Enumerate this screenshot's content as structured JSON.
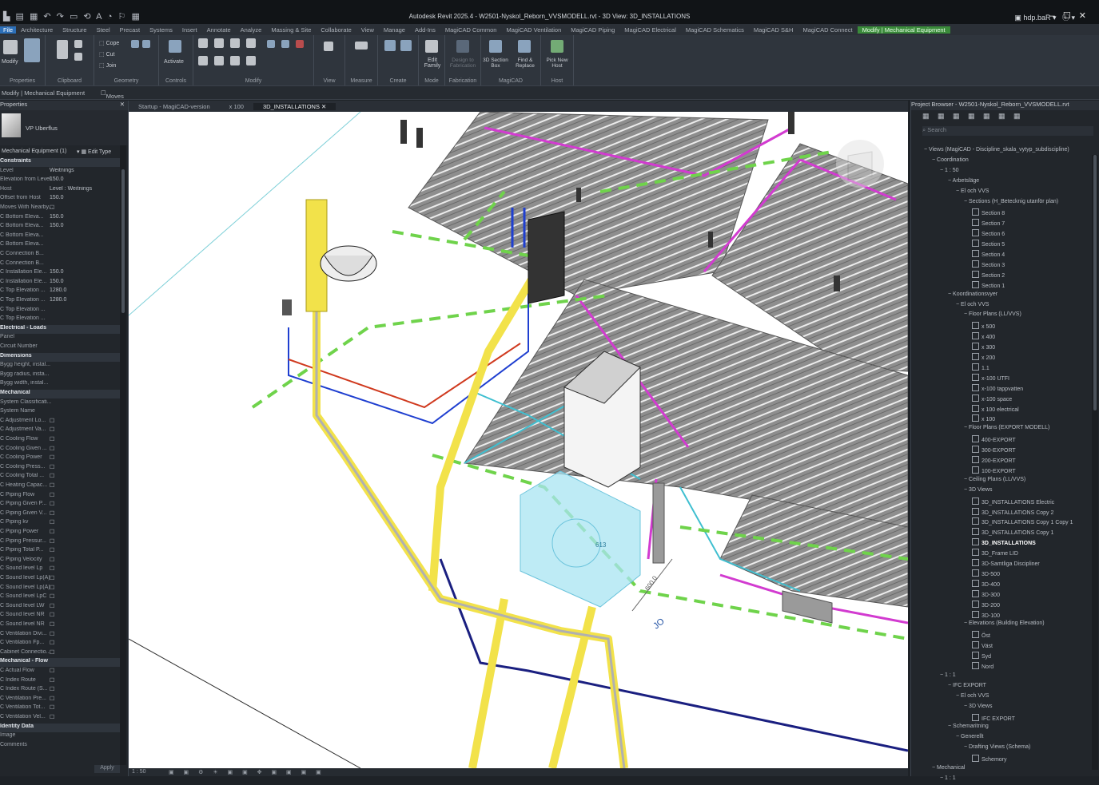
{
  "window": {
    "title": "Autodesk Revit 2025.4 - W2501-Nyskol_Reborn_VVSMODELL.rvt - 3D View: 3D_INSTALLATIONS",
    "user": "hdp.baR",
    "qat": "▙ ▤ ▦ ↶ ↷ ▭ ⟲ A ◔ ⚐ ▦"
  },
  "ribbon": {
    "tabs": [
      "File",
      "Architecture",
      "Structure",
      "Steel",
      "Precast",
      "Systems",
      "Insert",
      "Annotate",
      "Analyze",
      "Massing & Site",
      "Collaborate",
      "View",
      "Manage",
      "Add-Ins",
      "MagiCAD Common",
      "MagiCAD Ventilation",
      "MagiCAD Piping",
      "MagiCAD Electrical",
      "MagiCAD Schematics",
      "MagiCAD S&H",
      "MagiCAD Connect",
      "Modify | Mechanical Equipment"
    ],
    "groups": [
      "Properties",
      "Clipboard",
      "Geometry",
      "Controls",
      "Modify",
      "View",
      "Measure",
      "Create",
      "Mode",
      "Fabrication",
      "MagiCAD",
      "Host"
    ],
    "buttons": {
      "modify": "Modify",
      "cope": "Cope",
      "cut": "Cut",
      "join": "Join",
      "activate": "Activate",
      "edit_family": "Edit Family",
      "design_to_fabrication": "Design to Fabrication",
      "section_box": "3D Section Box",
      "find_replace": "Find & Replace",
      "pick_new_host": "Pick New Host"
    }
  },
  "options_bar": {
    "context": "Modify | Mechanical Equipment",
    "moves_with": "Moves With Nearby Elements"
  },
  "properties": {
    "title": "Properties",
    "type_name": "VP Uberflus",
    "selector": "Mechanical Equipment (1)",
    "edit_type": "Edit Type",
    "apply": "Apply",
    "rows": [
      {
        "cat": true,
        "label": "Constraints"
      },
      {
        "label": "Level",
        "value": "Weitnings"
      },
      {
        "label": "Elevation from Level",
        "value": "150.0"
      },
      {
        "label": "Host",
        "value": "Level : Weitnings"
      },
      {
        "label": "Offset from Host",
        "value": "150.0"
      },
      {
        "label": "Moves With Nearby...",
        "value": "☐"
      },
      {
        "label": "C Bottom Eleva...",
        "value": "150.0"
      },
      {
        "label": "C Bottom Eleva...",
        "value": "150.0"
      },
      {
        "label": "C Bottom Eleva...",
        "value": ""
      },
      {
        "label": "C Bottom Eleva...",
        "value": ""
      },
      {
        "label": "C Connection B...",
        "value": ""
      },
      {
        "label": "C Connection B...",
        "value": ""
      },
      {
        "label": "C Installation Ele...",
        "value": "150.0"
      },
      {
        "label": "C Installation Ele...",
        "value": "150.0"
      },
      {
        "label": "C Top Elevation ...",
        "value": "1280.0"
      },
      {
        "label": "C Top Elevation ...",
        "value": "1280.0"
      },
      {
        "label": "C Top Elevation ...",
        "value": ""
      },
      {
        "label": "C Top Elevation ...",
        "value": ""
      },
      {
        "cat": true,
        "label": "Electrical - Loads"
      },
      {
        "label": "Panel",
        "value": ""
      },
      {
        "label": "Circuit Number",
        "value": ""
      },
      {
        "cat": true,
        "label": "Dimensions"
      },
      {
        "label": "Bygg height, instal...",
        "value": ""
      },
      {
        "label": "Bygg radius, insta...",
        "value": ""
      },
      {
        "label": "Bygg width, instal...",
        "value": ""
      },
      {
        "cat": true,
        "label": "Mechanical"
      },
      {
        "label": "System Classificati...",
        "value": ""
      },
      {
        "label": "System Name",
        "value": ""
      },
      {
        "label": "C Adjustment Lo...",
        "value": "☐"
      },
      {
        "label": "C Adjustment Va...",
        "value": "☐"
      },
      {
        "label": "C Cooling Flow",
        "value": "☐"
      },
      {
        "label": "C Cooling Given ...",
        "value": "☐"
      },
      {
        "label": "C Cooling Power",
        "value": "☐"
      },
      {
        "label": "C Cooling Press...",
        "value": "☐"
      },
      {
        "label": "C Cooling Total ...",
        "value": "☐"
      },
      {
        "label": "C Heating Capac...",
        "value": "☐"
      },
      {
        "label": "C Piping Flow",
        "value": "☐"
      },
      {
        "label": "C Piping Given P...",
        "value": "☐"
      },
      {
        "label": "C Piping Given V...",
        "value": "☐"
      },
      {
        "label": "C Piping kv",
        "value": "☐"
      },
      {
        "label": "C Piping Power",
        "value": "☐"
      },
      {
        "label": "C Piping Pressur...",
        "value": "☐"
      },
      {
        "label": "C Piping Total P...",
        "value": "☐"
      },
      {
        "label": "C Piping Velocity",
        "value": "☐"
      },
      {
        "label": "C Sound level Lp",
        "value": "☐"
      },
      {
        "label": "C Sound level Lp(A)",
        "value": "☐"
      },
      {
        "label": "C Sound level Lp(A)",
        "value": "☐"
      },
      {
        "label": "C Sound level LpC",
        "value": "☐"
      },
      {
        "label": "C Sound level LW",
        "value": "☐"
      },
      {
        "label": "C Sound level NR",
        "value": "☐"
      },
      {
        "label": "C Sound level NR",
        "value": "☐"
      },
      {
        "label": "C Ventilation Divi...",
        "value": "☐"
      },
      {
        "label": "C Ventilation Fp...",
        "value": "☐"
      },
      {
        "label": "Cabinet Connectio...",
        "value": "☐"
      },
      {
        "cat": true,
        "label": "Mechanical - Flow"
      },
      {
        "label": "C Actual Flow",
        "value": "☐"
      },
      {
        "label": "C Index Route",
        "value": "☐"
      },
      {
        "label": "C Index Route (S...",
        "value": "☐"
      },
      {
        "label": "C Ventilation Pre...",
        "value": "☐"
      },
      {
        "label": "C Ventilation Tot...",
        "value": "☐"
      },
      {
        "label": "C Ventilation Vel...",
        "value": "☐"
      },
      {
        "cat": true,
        "label": "Identity Data"
      },
      {
        "label": "Image",
        "value": ""
      },
      {
        "label": "Comments",
        "value": ""
      }
    ]
  },
  "view_tabs": [
    {
      "label": "Startup - MagiCAD-version",
      "active": false
    },
    {
      "label": "x 100",
      "active": false
    },
    {
      "label": "3D_INSTALLATIONS",
      "active": true
    }
  ],
  "canvas": {
    "dim_text": "600.0",
    "tag_text": "JO",
    "label_text": "613"
  },
  "browser": {
    "title": "Project Browser - W2501-Nyskol_Reborn_VVSMODELL.rvt",
    "search_placeholder": "Search",
    "nodes": [
      {
        "d": 0,
        "t": "Views (MagiCAD - Discipline_skala_vytyp_subdiscipline)"
      },
      {
        "d": 1,
        "t": "Coordination"
      },
      {
        "d": 2,
        "t": "1 : 50"
      },
      {
        "d": 3,
        "t": "Arbetsläge"
      },
      {
        "d": 4,
        "t": "El och VVS"
      },
      {
        "d": 5,
        "t": "Sections (H_Betecknig utanför plan)"
      },
      {
        "d": 6,
        "t": "Section 8",
        "v": true
      },
      {
        "d": 6,
        "t": "Section 7",
        "v": true
      },
      {
        "d": 6,
        "t": "Section 6",
        "v": true
      },
      {
        "d": 6,
        "t": "Section 5",
        "v": true
      },
      {
        "d": 6,
        "t": "Section 4",
        "v": true
      },
      {
        "d": 6,
        "t": "Section 3",
        "v": true
      },
      {
        "d": 6,
        "t": "Section 2",
        "v": true
      },
      {
        "d": 6,
        "t": "Section 1",
        "v": true
      },
      {
        "d": 3,
        "t": "Koordinationsvyer"
      },
      {
        "d": 4,
        "t": "El och VVS"
      },
      {
        "d": 5,
        "t": "Floor Plans (LL/VVS)"
      },
      {
        "d": 6,
        "t": "x 500",
        "v": true
      },
      {
        "d": 6,
        "t": "x 400",
        "v": true
      },
      {
        "d": 6,
        "t": "x 300",
        "v": true
      },
      {
        "d": 6,
        "t": "x 200",
        "v": true
      },
      {
        "d": 6,
        "t": "1.1",
        "v": true
      },
      {
        "d": 6,
        "t": "x-100 UTFI",
        "v": true
      },
      {
        "d": 6,
        "t": "x-100 tappvatten",
        "v": true
      },
      {
        "d": 6,
        "t": "x-100 space",
        "v": true
      },
      {
        "d": 6,
        "t": "x 100 electrical",
        "v": true
      },
      {
        "d": 6,
        "t": "x 100",
        "v": true
      },
      {
        "d": 5,
        "t": "Floor Plans (EXPORT MODELL)"
      },
      {
        "d": 6,
        "t": "400-EXPORT",
        "v": true
      },
      {
        "d": 6,
        "t": "300-EXPORT",
        "v": true
      },
      {
        "d": 6,
        "t": "200-EXPORT",
        "v": true
      },
      {
        "d": 6,
        "t": "100-EXPORT",
        "v": true
      },
      {
        "d": 5,
        "t": "Ceiling Plans (LL/VVS)"
      },
      {
        "d": 5,
        "t": "3D Views"
      },
      {
        "d": 6,
        "t": "3D_INSTALLATIONS Electric",
        "v": true
      },
      {
        "d": 6,
        "t": "3D_INSTALLATIONS Copy 2",
        "v": true
      },
      {
        "d": 6,
        "t": "3D_INSTALLATIONS Copy 1 Copy 1",
        "v": true
      },
      {
        "d": 6,
        "t": "3D_INSTALLATIONS Copy 1",
        "v": true
      },
      {
        "d": 6,
        "t": "3D_INSTALLATIONS",
        "v": true,
        "sel": true
      },
      {
        "d": 6,
        "t": "3D_Frame LID",
        "v": true
      },
      {
        "d": 6,
        "t": "3D-Samtliga Discipliner",
        "v": true
      },
      {
        "d": 6,
        "t": "3D-500",
        "v": true
      },
      {
        "d": 6,
        "t": "3D-400",
        "v": true
      },
      {
        "d": 6,
        "t": "3D-300",
        "v": true
      },
      {
        "d": 6,
        "t": "3D-200",
        "v": true
      },
      {
        "d": 6,
        "t": "3D-100",
        "v": true
      },
      {
        "d": 5,
        "t": "Elevations (Building Elevation)"
      },
      {
        "d": 6,
        "t": "Öst",
        "v": true
      },
      {
        "d": 6,
        "t": "Väst",
        "v": true
      },
      {
        "d": 6,
        "t": "Syd",
        "v": true
      },
      {
        "d": 6,
        "t": "Nord",
        "v": true
      },
      {
        "d": 2,
        "t": "1 : 1"
      },
      {
        "d": 3,
        "t": "IFC EXPORT"
      },
      {
        "d": 4,
        "t": "El och VVS"
      },
      {
        "d": 5,
        "t": "3D Views"
      },
      {
        "d": 6,
        "t": "IFC EXPORT",
        "v": true
      },
      {
        "d": 3,
        "t": "Schemaritning"
      },
      {
        "d": 4,
        "t": "Generellt"
      },
      {
        "d": 5,
        "t": "Drafting Views (Schema)"
      },
      {
        "d": 6,
        "t": "Schemory",
        "v": true
      },
      {
        "d": 1,
        "t": "Mechanical"
      },
      {
        "d": 2,
        "t": "1 : 1"
      }
    ]
  },
  "status": {
    "scale_label": "1 : 50"
  },
  "colors": {
    "ribbon_bg": "#2f353d",
    "app_bg": "#1e2227",
    "accent_file": "#2c6fb8",
    "accent_context": "#3a8a3a",
    "pipe_yellow": "#f2e24a",
    "dash_green": "#6fd34b",
    "pipe_magenta": "#d23bd0",
    "pipe_cyan": "#3fbfd0"
  }
}
